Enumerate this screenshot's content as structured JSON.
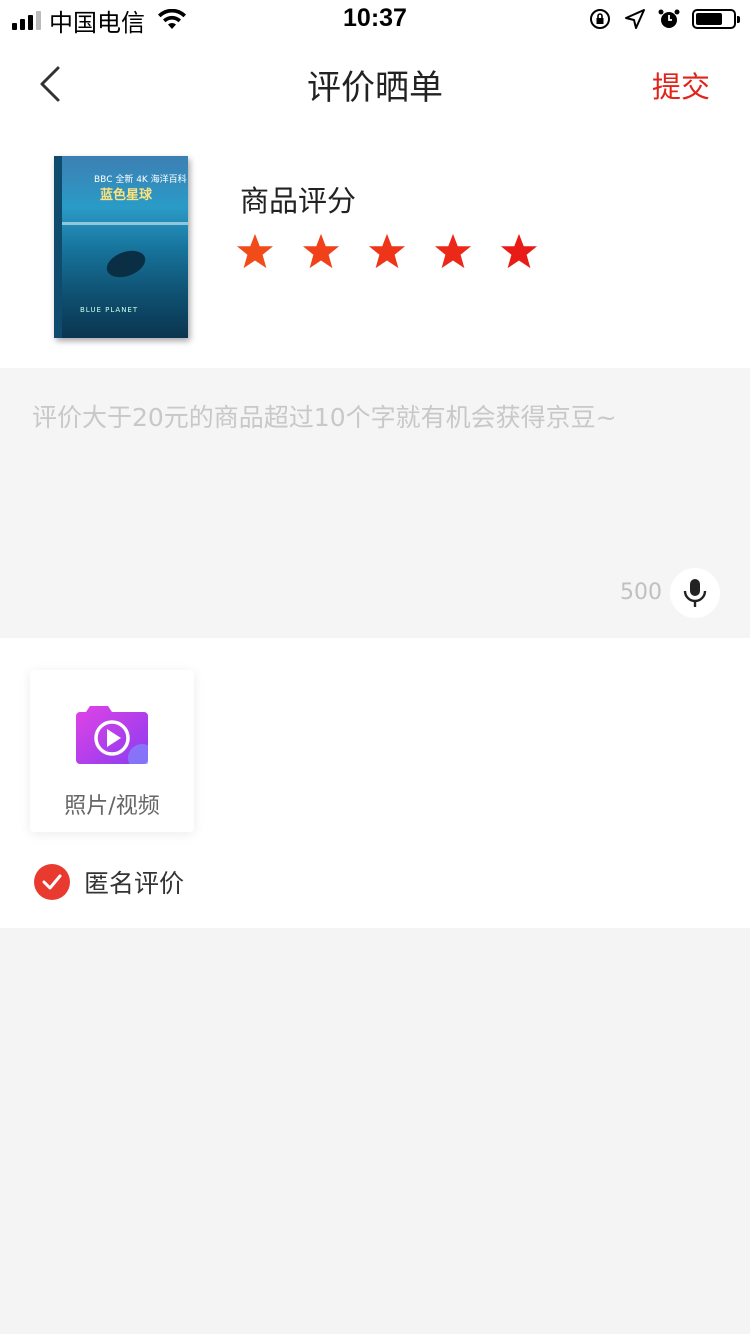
{
  "status_bar": {
    "carrier": "中国电信",
    "time": "10:37",
    "battery_level": 0.65
  },
  "nav": {
    "title": "评价晒单",
    "submit_label": "提交"
  },
  "product": {
    "cover_text_top": "BBC 全新 4K 海洋百科",
    "cover_title": "蓝色星球",
    "cover_text_bottom": "BLUE PLANET",
    "rating_label": "商品评分",
    "rating": 5,
    "rating_max": 5
  },
  "comment": {
    "placeholder": "评价大于20元的商品超过10个字就有机会获得京豆~",
    "char_limit": "500"
  },
  "media": {
    "upload_label": "照片/视频"
  },
  "anonymous": {
    "label": "匿名评价",
    "checked": true
  },
  "colors": {
    "accent": "#e2231a",
    "star": "#f24b1a"
  }
}
